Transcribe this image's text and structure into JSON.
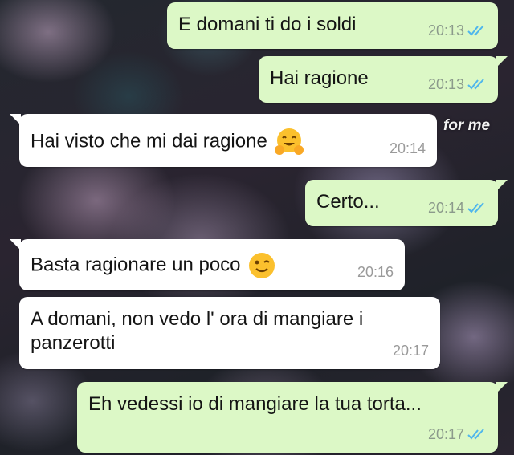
{
  "wallpaper_caption": "for me",
  "colors": {
    "outgoing_bubble": "#dcf8c6",
    "incoming_bubble": "#ffffff",
    "read_ticks": "#4fb6ec"
  },
  "messages": [
    {
      "direction": "outgoing",
      "text": "E domani ti do i soldi",
      "time": "20:13",
      "status": "read-ticks-icon"
    },
    {
      "direction": "outgoing",
      "text": "Hai ragione",
      "time": "20:13",
      "status": "read-ticks-icon"
    },
    {
      "direction": "incoming",
      "text": "Hai visto che mi dai ragione",
      "emoji": "hugging-face-emoji",
      "time": "20:14"
    },
    {
      "direction": "outgoing",
      "text": "Certo...",
      "time": "20:14",
      "status": "read-ticks-icon"
    },
    {
      "direction": "incoming",
      "text": "Basta ragionare un poco",
      "emoji": "winking-face-emoji",
      "time": "20:16"
    },
    {
      "direction": "incoming",
      "text": "A domani, non vedo l' ora di mangiare i panzerotti",
      "time": "20:17"
    },
    {
      "direction": "outgoing",
      "text": "Eh vedessi io di mangiare la tua torta...",
      "time": "20:17",
      "status": "read-ticks-icon"
    }
  ]
}
